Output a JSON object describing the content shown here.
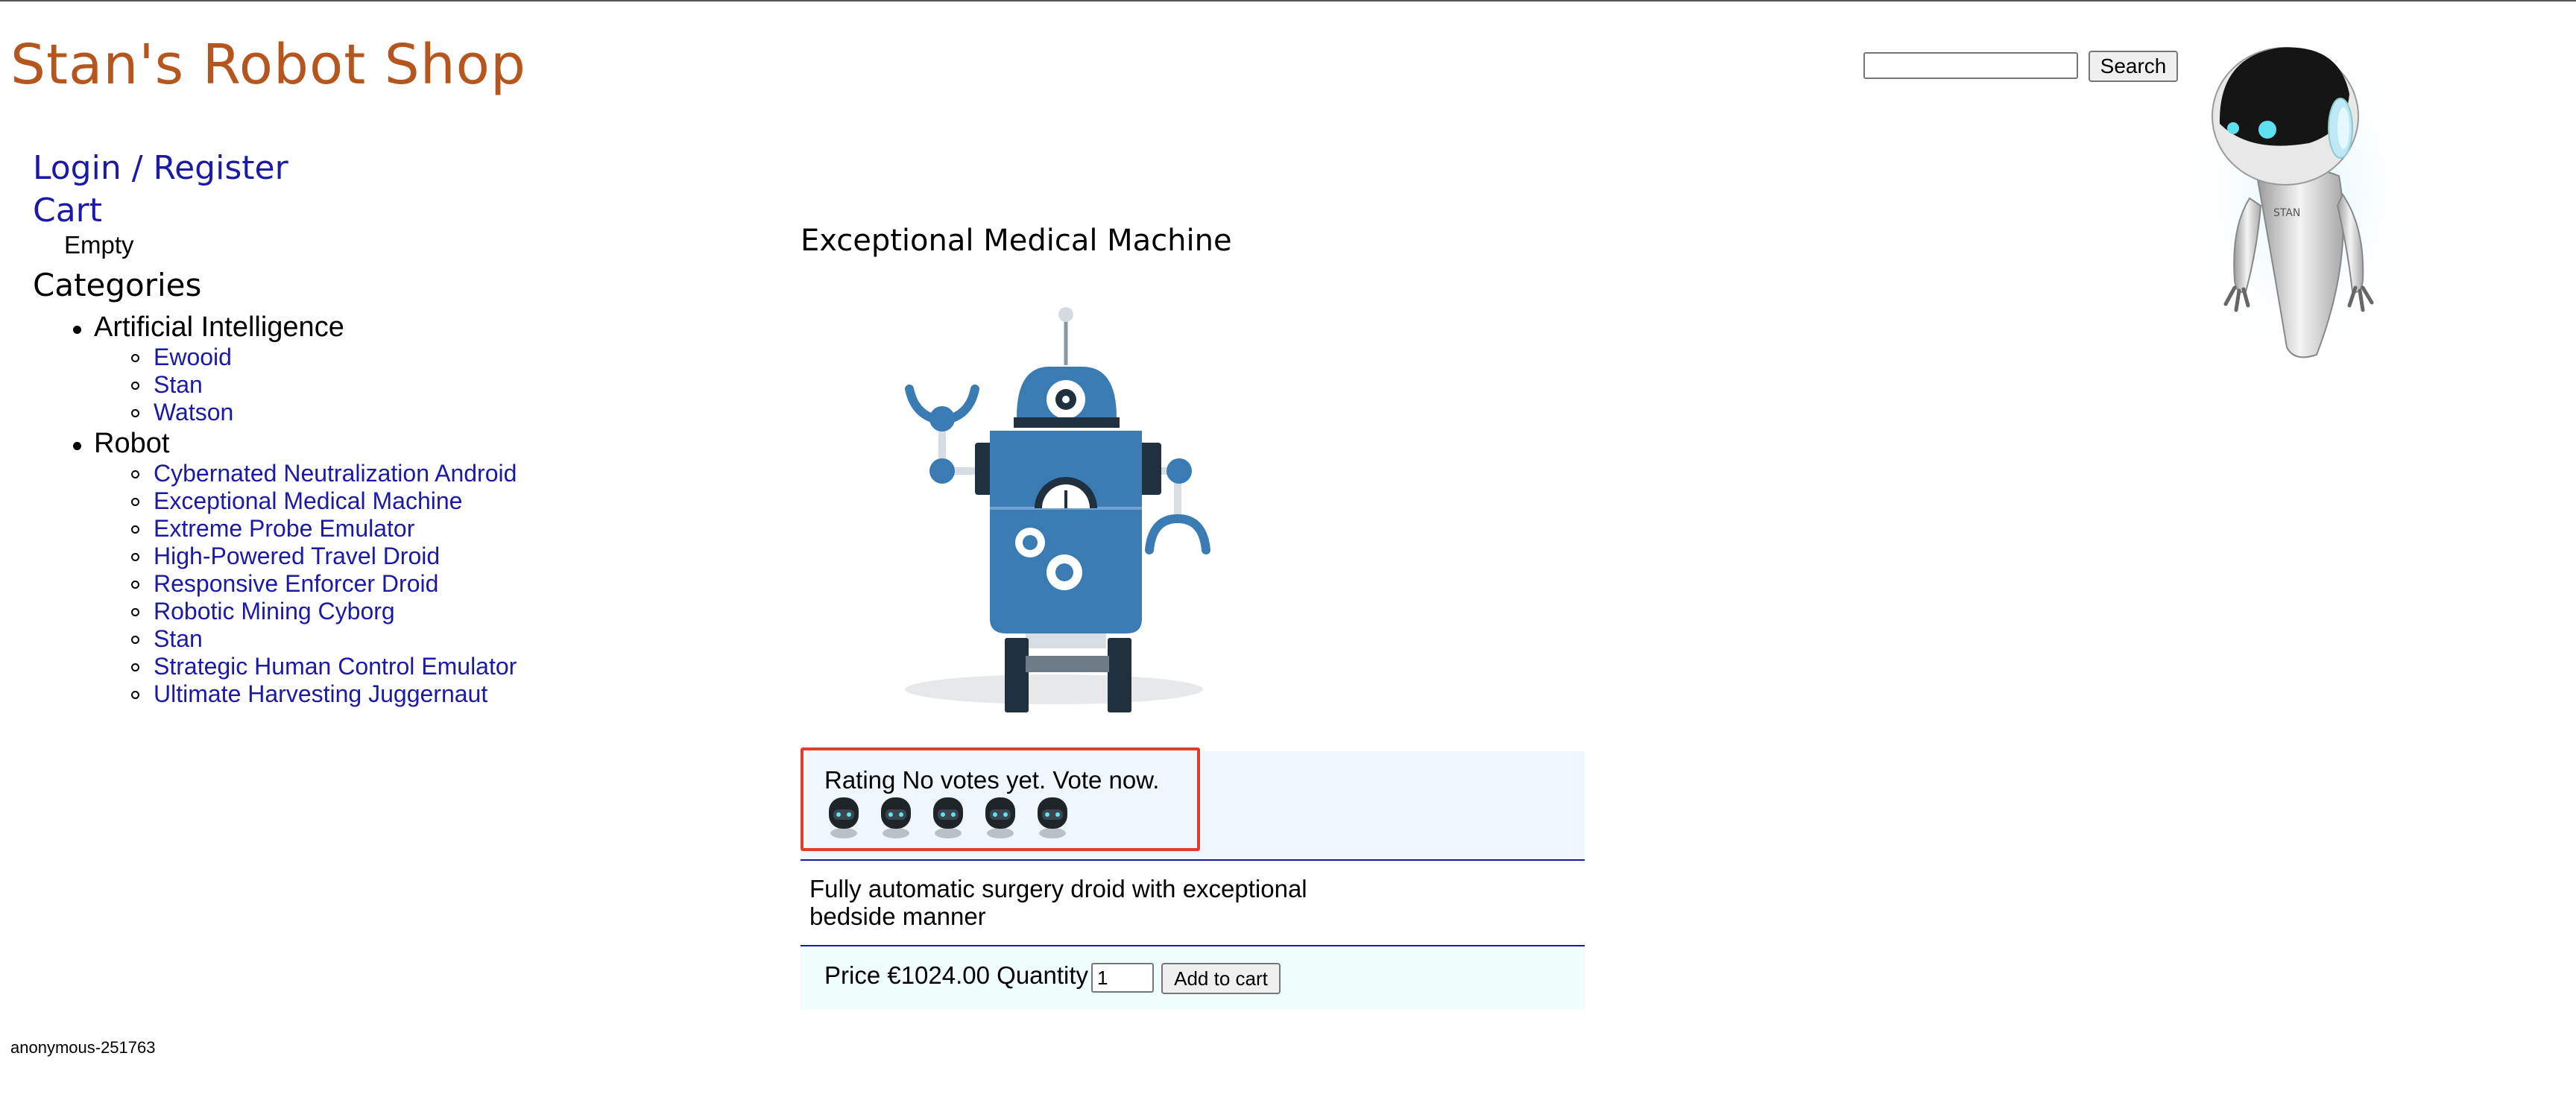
{
  "header": {
    "logo_text": "Stan's Robot Shop",
    "search": {
      "value": "",
      "placeholder": "",
      "button_label": "Search"
    }
  },
  "sidebar": {
    "login_label": "Login / Register",
    "cart_label": "Cart",
    "cart_status": "Empty",
    "categories_heading": "Categories",
    "categories": [
      {
        "name": "Artificial Intelligence",
        "items": [
          "Ewooid",
          "Stan",
          "Watson"
        ]
      },
      {
        "name": "Robot",
        "items": [
          "Cybernated Neutralization Android",
          "Exceptional Medical Machine",
          "Extreme Probe Emulator",
          "High-Powered Travel Droid",
          "Responsive Enforcer Droid",
          "Robotic Mining Cyborg",
          "Stan",
          "Strategic Human Control Emulator",
          "Ultimate Harvesting Juggernaut"
        ]
      }
    ]
  },
  "product": {
    "title": "Exceptional Medical Machine",
    "rating_text": "Rating No votes yet. Vote now.",
    "rating_max": 5,
    "rating_current": 0,
    "description": "Fully automatic surgery droid with exceptional bedside manner",
    "price_text": "Price €1024.00 Quantity",
    "quantity": "1",
    "add_to_cart_label": "Add to cart"
  },
  "footer": {
    "user_id": "anonymous-251763"
  },
  "colors": {
    "logo": "#b5561f",
    "link": "#1a1aa6",
    "rating_highlight": "#e53b2c",
    "robot_blue": "#3b7bb3"
  }
}
